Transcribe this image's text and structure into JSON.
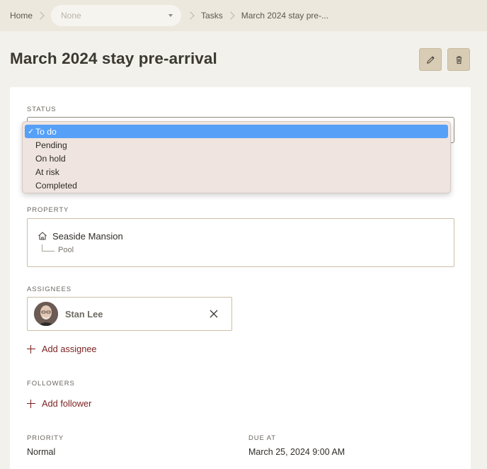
{
  "breadcrumb": {
    "home": "Home",
    "select_value": "None",
    "tasks": "Tasks",
    "current": "March 2024 stay pre-..."
  },
  "page": {
    "title": "March 2024 stay pre-arrival"
  },
  "status": {
    "label": "STATUS",
    "options": [
      "To do",
      "Pending",
      "On hold",
      "At risk",
      "Completed"
    ],
    "selected": "To do",
    "check": "✓"
  },
  "property": {
    "label": "PROPERTY",
    "name": "Seaside Mansion",
    "sub": "Pool"
  },
  "assignees": {
    "label": "ASSIGNEES",
    "items": [
      {
        "name": "Stan Lee"
      }
    ],
    "add_label": "Add assignee"
  },
  "followers": {
    "label": "FOLLOWERS",
    "add_label": "Add follower"
  },
  "priority": {
    "label": "PRIORITY",
    "value": "Normal"
  },
  "due": {
    "label": "DUE AT",
    "value": "March 25, 2024 9:00 AM"
  },
  "colors": {
    "accent": "#7a1f1f",
    "selection": "#56a0f8",
    "button_bg": "#d8ccb4"
  }
}
